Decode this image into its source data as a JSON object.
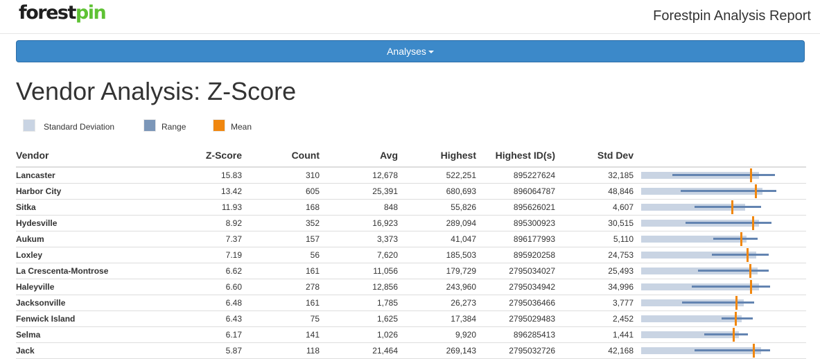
{
  "header": {
    "logo_main": "forest",
    "logo_accent": "pin",
    "report_title": "Forestpin Analysis Report"
  },
  "nav": {
    "menu_label": "Analyses"
  },
  "page": {
    "title": "Vendor Analysis: Z-Score"
  },
  "legend": [
    {
      "label": "Standard Deviation",
      "color": "#c9d4e3"
    },
    {
      "label": "Range",
      "color": "#7b96b8"
    },
    {
      "label": "Mean",
      "color": "#f0870f"
    }
  ],
  "table": {
    "columns": [
      "Vendor",
      "Z-Score",
      "Count",
      "Avg",
      "Highest",
      "Highest ID(s)",
      "Std Dev"
    ],
    "rows": [
      {
        "vendor": "Lancaster",
        "zscore": "15.83",
        "count": "310",
        "avg": "12,678",
        "highest": "522,251",
        "highest_ids": "895227624",
        "std_dev": "32,185",
        "std_end": 0.75,
        "range_start": 0.2,
        "range_end": 0.85,
        "mean": 0.695
      },
      {
        "vendor": "Harbor City",
        "zscore": "13.42",
        "count": "605",
        "avg": "25,391",
        "highest": "680,693",
        "highest_ids": "896064787",
        "std_dev": "48,846",
        "std_end": 0.77,
        "range_start": 0.25,
        "range_end": 0.86,
        "mean": 0.725
      },
      {
        "vendor": "Sitka",
        "zscore": "11.93",
        "count": "168",
        "avg": "848",
        "highest": "55,826",
        "highest_ids": "895626021",
        "std_dev": "4,607",
        "std_end": 0.66,
        "range_start": 0.34,
        "range_end": 0.76,
        "mean": 0.575
      },
      {
        "vendor": "Hydesville",
        "zscore": "8.92",
        "count": "352",
        "avg": "16,923",
        "highest": "289,094",
        "highest_ids": "895300923",
        "std_dev": "30,515",
        "std_end": 0.75,
        "range_start": 0.28,
        "range_end": 0.83,
        "mean": 0.71
      },
      {
        "vendor": "Aukum",
        "zscore": "7.37",
        "count": "157",
        "avg": "3,373",
        "highest": "41,047",
        "highest_ids": "896177993",
        "std_dev": "5,110",
        "std_end": 0.67,
        "range_start": 0.46,
        "range_end": 0.74,
        "mean": 0.635
      },
      {
        "vendor": "Loxley",
        "zscore": "7.19",
        "count": "56",
        "avg": "7,620",
        "highest": "185,503",
        "highest_ids": "895920258",
        "std_dev": "24,753",
        "std_end": 0.73,
        "range_start": 0.45,
        "range_end": 0.81,
        "mean": 0.675
      },
      {
        "vendor": "La Crescenta-Montrose",
        "zscore": "6.62",
        "count": "161",
        "avg": "11,056",
        "highest": "179,729",
        "highest_ids": "2795034027",
        "std_dev": "25,493",
        "std_end": 0.74,
        "range_start": 0.36,
        "range_end": 0.81,
        "mean": 0.69
      },
      {
        "vendor": "Haleyville",
        "zscore": "6.60",
        "count": "278",
        "avg": "12,856",
        "highest": "243,960",
        "highest_ids": "2795034942",
        "std_dev": "34,996",
        "std_end": 0.75,
        "range_start": 0.32,
        "range_end": 0.82,
        "mean": 0.695
      },
      {
        "vendor": "Jacksonville",
        "zscore": "6.48",
        "count": "161",
        "avg": "1,785",
        "highest": "26,273",
        "highest_ids": "2795036466",
        "std_dev": "3,777",
        "std_end": 0.65,
        "range_start": 0.26,
        "range_end": 0.72,
        "mean": 0.605
      },
      {
        "vendor": "Fenwick Island",
        "zscore": "6.43",
        "count": "75",
        "avg": "1,625",
        "highest": "17,384",
        "highest_ids": "2795029483",
        "std_dev": "2,452",
        "std_end": 0.64,
        "range_start": 0.51,
        "range_end": 0.71,
        "mean": 0.6
      },
      {
        "vendor": "Selma",
        "zscore": "6.17",
        "count": "141",
        "avg": "1,026",
        "highest": "9,920",
        "highest_ids": "896285413",
        "std_dev": "1,441",
        "std_end": 0.62,
        "range_start": 0.4,
        "range_end": 0.68,
        "mean": 0.585
      },
      {
        "vendor": "Jack",
        "zscore": "5.87",
        "count": "118",
        "avg": "21,464",
        "highest": "269,143",
        "highest_ids": "2795032726",
        "std_dev": "42,168",
        "std_end": 0.76,
        "range_start": 0.34,
        "range_end": 0.82,
        "mean": 0.715
      }
    ]
  }
}
